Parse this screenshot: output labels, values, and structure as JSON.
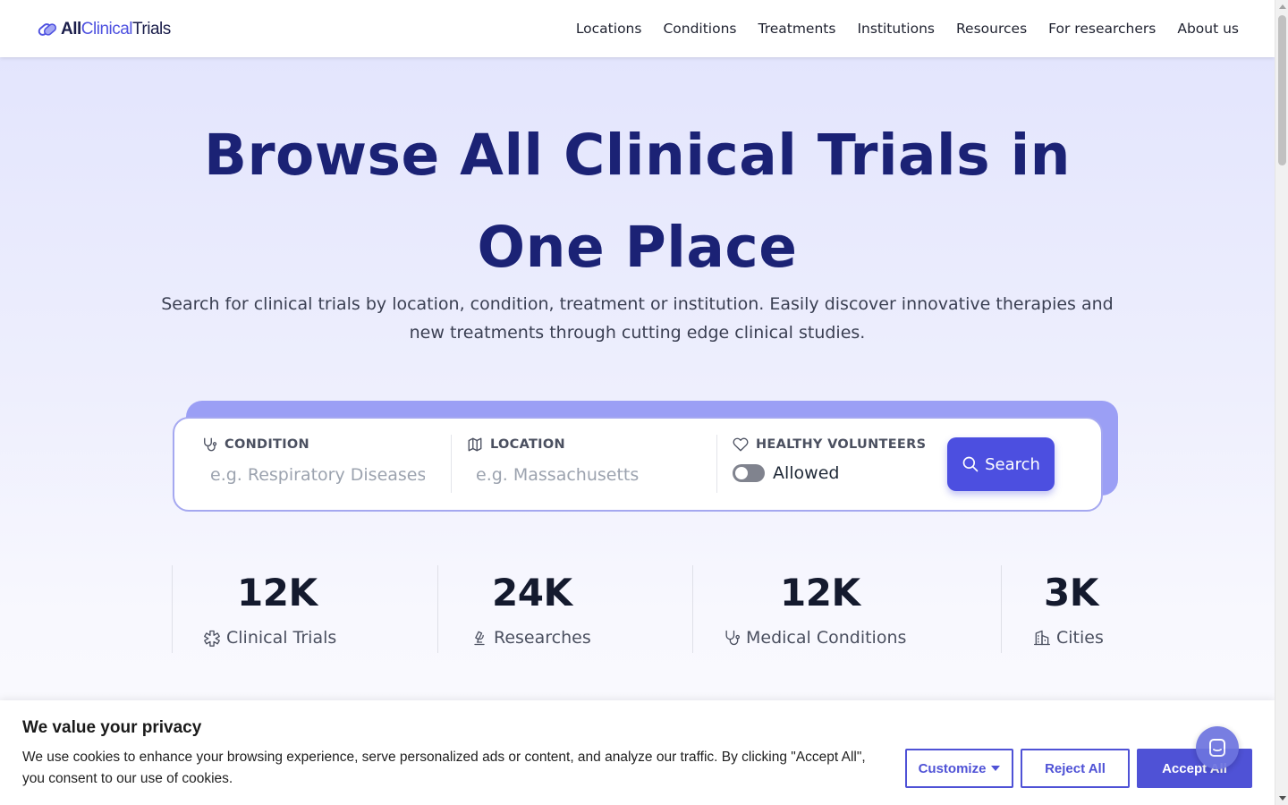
{
  "brand": {
    "logo_all": "All",
    "logo_clinical": "Clinical",
    "logo_trials": "Trials",
    "icon": "capsule-logo-icon"
  },
  "nav": {
    "items": [
      "Locations",
      "Conditions",
      "Treatments",
      "Institutions",
      "Resources",
      "For researchers",
      "About us"
    ]
  },
  "hero": {
    "title": "Browse All Clinical Trials in One Place",
    "subtitle": "Search for clinical trials by location, condition, treatment or institution. Easily discover innovative therapies and new treatments through cutting edge clinical studies."
  },
  "search": {
    "condition_label": "CONDITION",
    "condition_placeholder": "e.g. Respiratory Diseases",
    "condition_value": "",
    "location_label": "LOCATION",
    "location_placeholder": "e.g. Massachusetts",
    "location_value": "",
    "volunteers_label": "HEALTHY VOLUNTEERS",
    "volunteers_toggle_label": "Allowed",
    "volunteers_toggle_on": false,
    "button_label": "Search",
    "icons": {
      "condition": "stethoscope-icon",
      "location": "map-icon",
      "volunteers": "heart-icon",
      "button": "search-icon"
    }
  },
  "stats": [
    {
      "value": "12K",
      "label": "Clinical Trials",
      "icon": "asterisk-icon"
    },
    {
      "value": "24K",
      "label": "Researches",
      "icon": "microscope-icon"
    },
    {
      "value": "12K",
      "label": "Medical Conditions",
      "icon": "stethoscope-icon"
    },
    {
      "value": "3K",
      "label": "Cities",
      "icon": "building-icon"
    }
  ],
  "cookie": {
    "title": "We value your privacy",
    "text": "We use cookies to enhance your browsing experience, serve personalized ads or content, and analyze our traffic. By clicking \"Accept All\", you consent to our use of cookies.",
    "customize_label": "Customize",
    "reject_label": "Reject All",
    "accept_label": "Accept All"
  },
  "colors": {
    "primary": "#4c4fe0",
    "title": "#1b2275",
    "search_shadow": "#9b9ff5",
    "hero_top": "#e3e5fd"
  }
}
